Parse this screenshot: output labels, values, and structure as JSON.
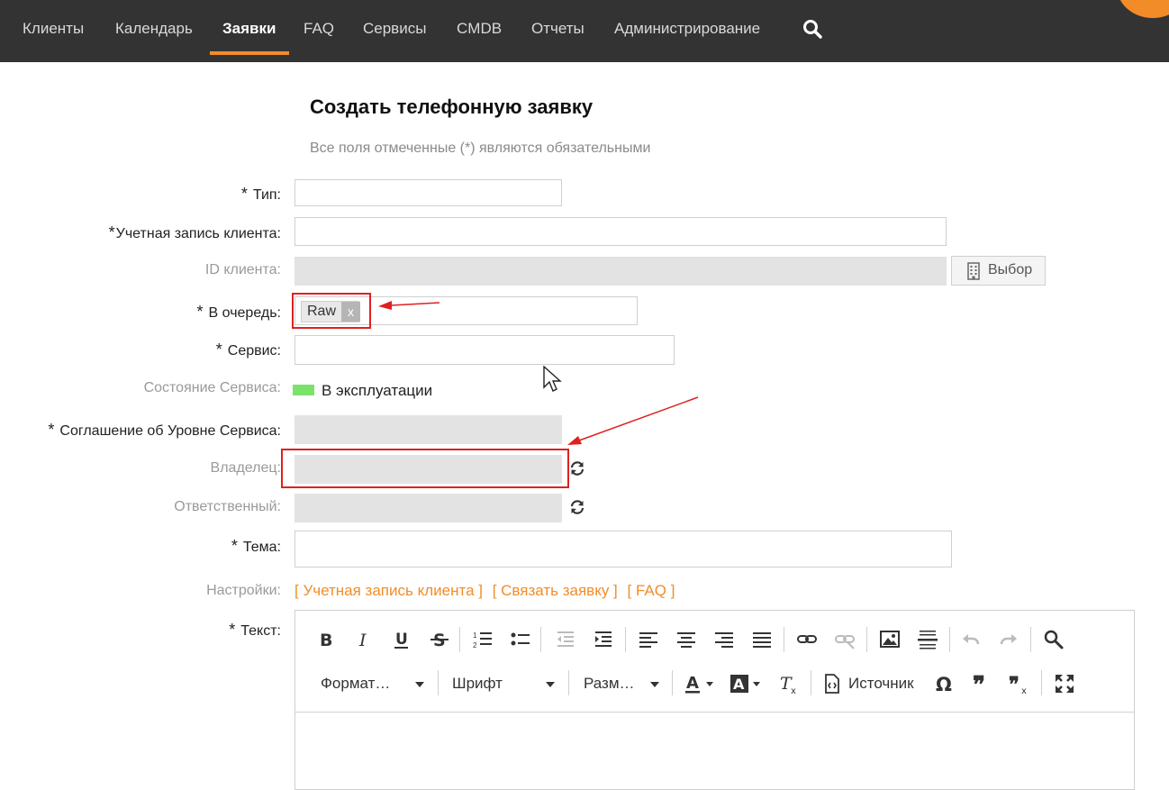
{
  "nav": {
    "items": [
      "Клиенты",
      "Календарь",
      "Заявки",
      "FAQ",
      "Сервисы",
      "CMDB",
      "Отчеты",
      "Администрирование"
    ],
    "active_index": 2
  },
  "page": {
    "title": "Создать телефонную заявку",
    "subtitle": "Все поля отмеченные (*) являются обязательными"
  },
  "form": {
    "type_label": "Тип:",
    "customer_account_label": "Учетная запись клиента:",
    "customer_id_label": "ID клиента:",
    "select_button": "Выбор",
    "queue_label": "В очередь:",
    "queue_tag": "Raw",
    "queue_tag_remove": "x",
    "service_label": "Сервис:",
    "service_state_label": "Состояние Сервиса:",
    "service_state_value": "В эксплуатации",
    "sla_label": "Соглашение об Уровне Сервиса:",
    "owner_label": "Владелец:",
    "responsible_label": "Ответственный:",
    "subject_label": "Тема:",
    "settings_label": "Настройки:",
    "settings_links": [
      "[ Учетная запись клиента ]",
      "[ Связать заявку ]",
      "[ FAQ ]"
    ],
    "text_label": "Текст:",
    "required_mark": "*"
  },
  "editor": {
    "format_label": "Формат…",
    "font_label": "Шрифт",
    "size_label": "Разм…",
    "source_label": "Источник"
  },
  "colors": {
    "accent": "#f28c28",
    "nav_bg": "#333333",
    "status_ok": "#7be26a",
    "annotation_red": "#e02020"
  }
}
